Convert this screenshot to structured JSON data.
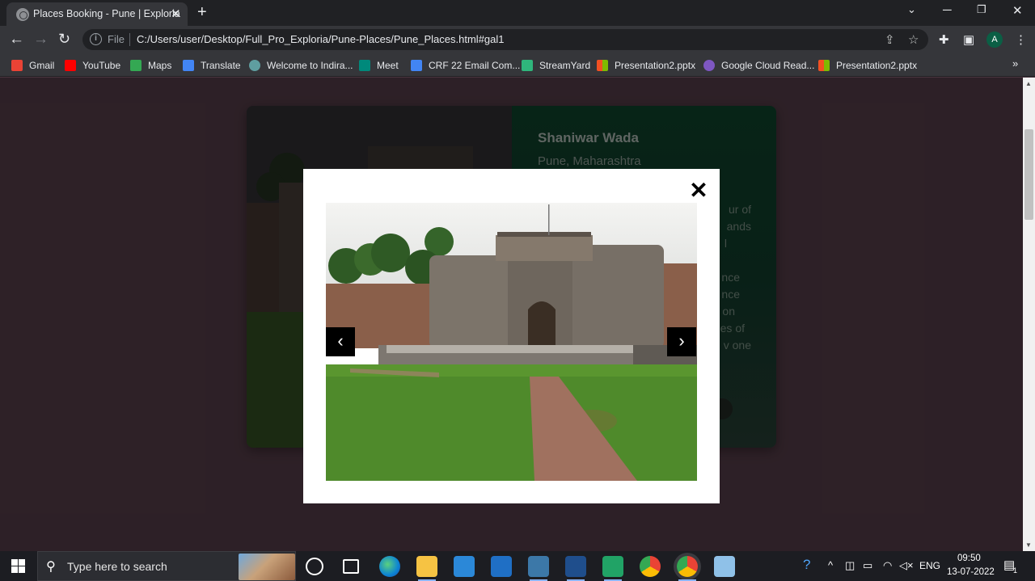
{
  "browser": {
    "tab_title": "Places Booking - Pune | Exploria",
    "tab_close": "✕",
    "new_tab": "+",
    "file_label": "File",
    "url": "C:/Users/user/Desktop/Full_Pro_Exploria/Pune-Places/Pune_Places.html#gal1",
    "avatar_letter": "A"
  },
  "bookmarks": [
    {
      "label": "Gmail",
      "color": "#ea4335"
    },
    {
      "label": "YouTube",
      "color": "#ff0000"
    },
    {
      "label": "Maps",
      "color": "#34a853"
    },
    {
      "label": "Translate",
      "color": "#4285f4"
    },
    {
      "label": "Welcome to Indira...",
      "color": "#5f9ea0"
    },
    {
      "label": "Meet",
      "color": "#00897b"
    },
    {
      "label": "CRF 22 Email Com...",
      "color": "#4285f4"
    },
    {
      "label": "StreamYard",
      "color": "#2fb67c"
    },
    {
      "label": "Presentation2.pptx",
      "color": "#f25022"
    },
    {
      "label": "Google Cloud Read...",
      "color": "#7e57c2"
    },
    {
      "label": "Presentation2.pptx",
      "color": "#f25022"
    }
  ],
  "bookmarks_more": "»",
  "card": {
    "title": "Shaniwar Wada",
    "subtitle": "Pune, Maharashtra",
    "desc_fragments": [
      "ur of",
      "ands",
      "l",
      "nce",
      "nce",
      "on",
      "es of",
      "v one"
    ]
  },
  "lightbox": {
    "close": "✕",
    "prev": "‹",
    "next": "›"
  },
  "taskbar": {
    "search_placeholder": "Type here to search",
    "language": "ENG",
    "time": "09:50",
    "date": "13-07-2022",
    "notification_count": "1"
  }
}
